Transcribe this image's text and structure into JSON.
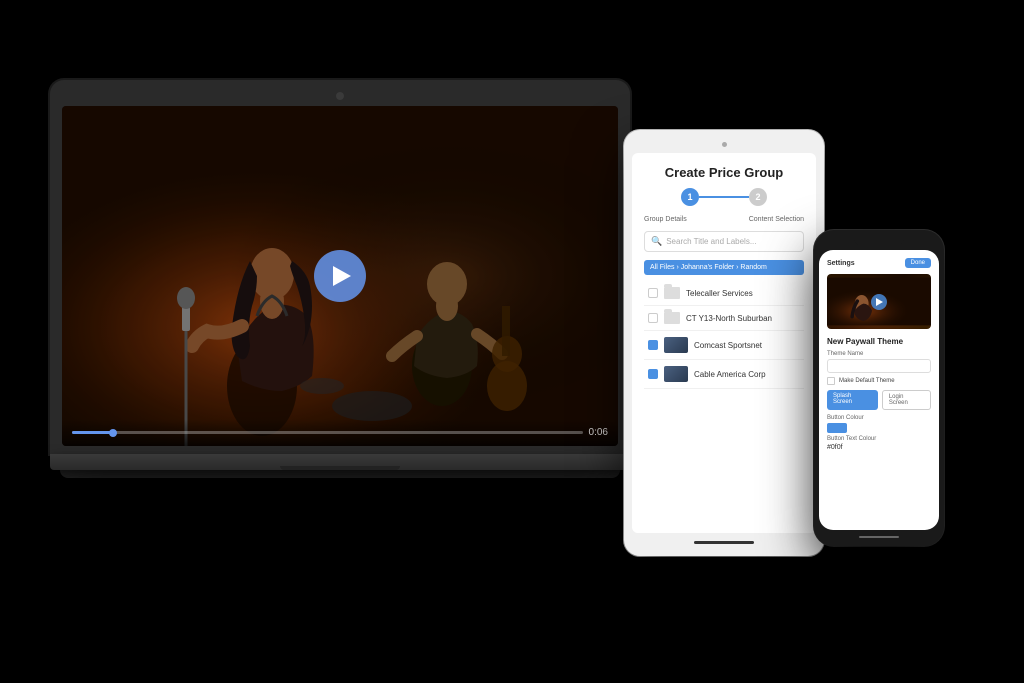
{
  "scene": {
    "background": "#000000"
  },
  "laptop": {
    "video": {
      "alt": "Live music performance - singer with microphone",
      "time_current": "0:06",
      "time_total": "0:06",
      "progress_percent": 8
    },
    "play_button_label": "Play"
  },
  "tablet": {
    "title": "Create Price Group",
    "step1_label": "Group Details",
    "step2_label": "Content Selection",
    "search_placeholder": "Search Title and Labels...",
    "breadcrumb": "All Files › Johanna's Folder › Random",
    "rows": [
      {
        "checked": false,
        "type": "folder",
        "name": "Telecaller Services"
      },
      {
        "checked": false,
        "type": "folder",
        "name": "CT Y13-North Suburban"
      },
      {
        "checked": true,
        "type": "video",
        "name": "Comcast Sportsnet"
      },
      {
        "checked": true,
        "type": "video",
        "name": "Cable America Corp"
      }
    ]
  },
  "phone": {
    "header_text": "Settings",
    "header_btn": "Done",
    "section_title": "New Paywall Theme",
    "theme_name_label": "Theme Name",
    "theme_name_value": "",
    "make_default_label": "Make Default Theme",
    "btn_splash": "Splash Screen",
    "btn_login": "Login Screen",
    "button_colour_label": "Button Colour",
    "button_colour_value": "#ffffff",
    "button_text_colour_label": "Button Text Colour",
    "button_text_colour_value": "#0f0f"
  }
}
